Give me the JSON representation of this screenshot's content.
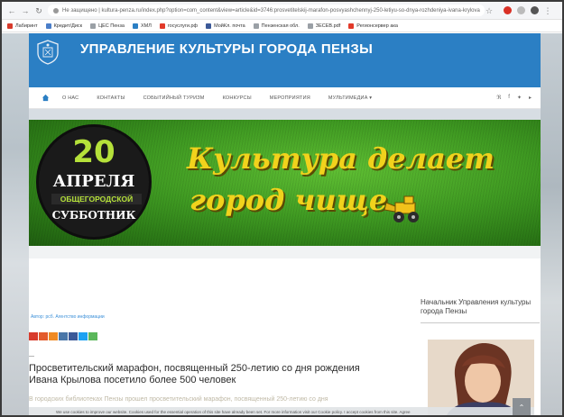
{
  "browser": {
    "address": "Не защищено | kultura-penza.ru/index.php?option=com_content&view=article&id=3746:prosvetitelskij-marafon-posvyashchennyj-250-letiyu-so-dnya-rozhdeniya-ivana-krylova",
    "bookmarks": [
      {
        "label": "Лабиринт",
        "icon": "bookmark-red-icon",
        "color": "#d83b2c"
      },
      {
        "label": "Кредит/Диск",
        "icon": "folder-icon",
        "color": "#4a7ec9"
      },
      {
        "label": "ЦЕС Пенза",
        "icon": "page-icon",
        "color": "#9aa0a6"
      },
      {
        "label": "ХМЛ",
        "icon": "globe-icon",
        "color": "#2b7fc4"
      },
      {
        "label": "госуслуги.рф",
        "icon": "yandex-icon",
        "color": "#e23a2a"
      },
      {
        "label": "МойКл. почта",
        "icon": "mail-icon",
        "color": "#3b5998"
      },
      {
        "label": "Пензенская обл.",
        "icon": "page-icon",
        "color": "#9aa0a6"
      },
      {
        "label": "ЗЕСЕВ.pdf",
        "icon": "page-icon",
        "color": "#9aa0a6"
      },
      {
        "label": "Регионсервер ака",
        "icon": "s-icon",
        "color": "#e23a2a"
      }
    ]
  },
  "site": {
    "title": "УПРАВЛЕНИЕ КУЛЬТУРЫ ГОРОДА ПЕНЗЫ",
    "brand_color": "#2b7fc4"
  },
  "nav": {
    "items": [
      "О НАС",
      "КОНТАКТЫ",
      "СОБЫТИЙНЫЙ ТУРИЗМ",
      "КОНКУРСЫ",
      "МЕРОПРИЯТИЯ",
      "МУЛЬТИМЕДИА ▾"
    ]
  },
  "banner": {
    "day": "20",
    "month": "АПРЕЛЯ",
    "line1": "ОБЩЕГОРОДСКОЙ",
    "line2": "СУББОТНИК",
    "slogan1": "Культура делает",
    "slogan2": "город чище"
  },
  "article": {
    "breadcrumb": "Автор: рсб. Агентство информации",
    "dash": "—",
    "headline": "Просветительский марафон, посвященный 250-летию со дня рождения Ивана Крылова посетило более 500 человек",
    "lead": "В городских библиотеках Пензы прошел просветительский марафон, посвященный 250-летию со дня"
  },
  "sidebar": {
    "title": "Начальник Управления культуры города Пензы"
  },
  "cookie": {
    "text": "We use cookies to improve our website. Cookies used for the essential operation of this site have already been set. For more information visit our Cookie policy.   I accept cookies from this site.   Agree"
  }
}
